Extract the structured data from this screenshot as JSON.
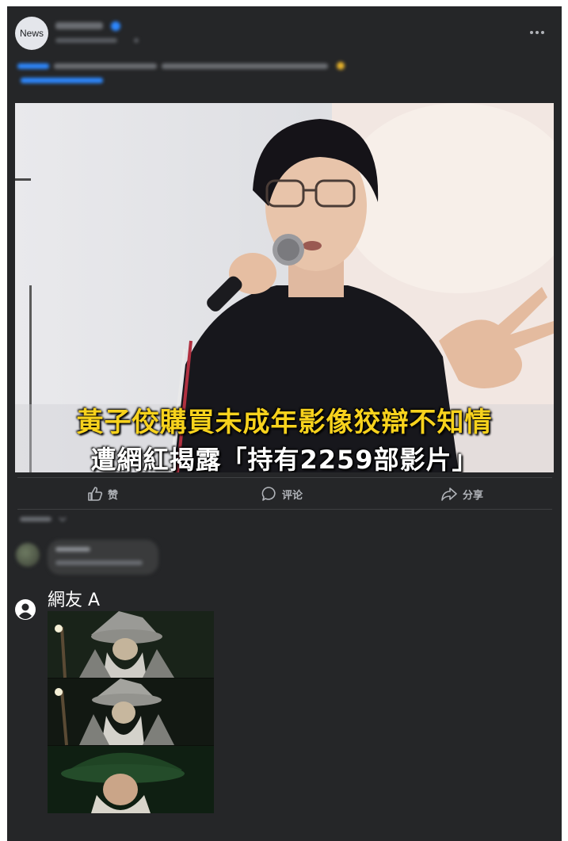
{
  "post": {
    "page_avatar_label": "News",
    "page_name": "",
    "meta": "",
    "text_line1": "",
    "text_line2": "",
    "photo_headline_line1": "黃子佼購買未成年影像狡辯不知情",
    "photo_headline_line2": "遭網紅揭露「持有2259部影片」"
  },
  "actions": {
    "like_label": "赞",
    "comment_label": "评论",
    "share_label": "分享"
  },
  "comments": {
    "sort_label": "",
    "first_comment_name": "",
    "first_comment_text": ""
  },
  "reply": {
    "user_name": "網友 A"
  },
  "colors": {
    "card_bg": "#252628",
    "headline_yellow": "#f7d21d",
    "text_secondary": "#b0b3b8",
    "accent_blue": "#2d88ff"
  },
  "icons": [
    "more-icon",
    "like-icon",
    "comment-icon",
    "share-icon",
    "user-icon",
    "verified-icon"
  ]
}
